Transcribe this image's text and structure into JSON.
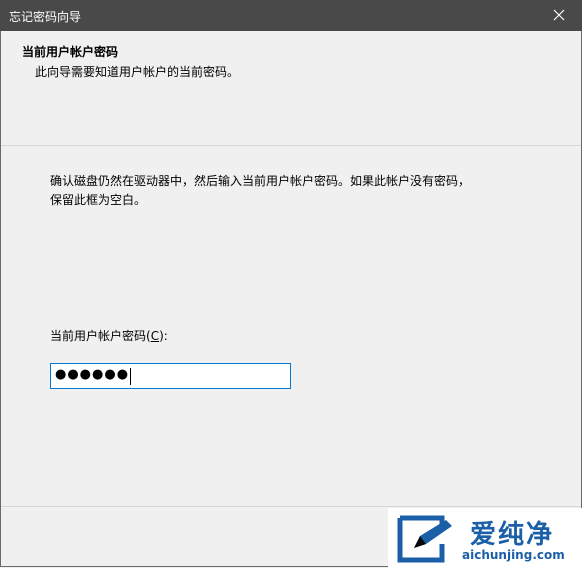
{
  "window": {
    "title": "忘记密码向导"
  },
  "header": {
    "title": "当前用户帐户密码",
    "subtitle": "此向导需要知道用户帐户的当前密码。"
  },
  "body": {
    "instructions_line1": "确认磁盘仍然在驱动器中，然后输入当前用户帐户密码。如果此帐户没有密码，",
    "instructions_line2": "保留此框为空白。",
    "password_label_prefix": "当前用户帐户密码(",
    "password_label_accel": "C",
    "password_label_suffix": "):",
    "password_masked": "●●●●●●"
  },
  "watermark": {
    "brand": "爱纯净",
    "url": "aichunjing.com"
  },
  "colors": {
    "titlebar": "#494949",
    "input_focus_border": "#0078d7",
    "watermark_blue": "#1b5fa8"
  }
}
